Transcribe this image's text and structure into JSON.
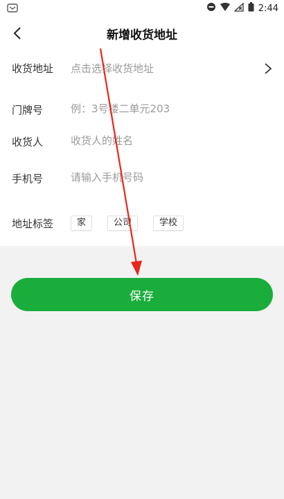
{
  "status_bar": {
    "time": "2:44",
    "icons": [
      "message-icon",
      "dnd-icon",
      "wifi-icon",
      "no-signal-icon",
      "battery-icon"
    ]
  },
  "header": {
    "title": "新增收货地址",
    "back_icon": "chevron-left-icon"
  },
  "form": {
    "address": {
      "label": "收货地址",
      "placeholder": "点击选择收货地址"
    },
    "door_number": {
      "label": "门牌号",
      "placeholder": "例：3号楼二单元203"
    },
    "receiver": {
      "label": "收货人",
      "placeholder": "收货人的姓名"
    },
    "phone": {
      "label": "手机号",
      "placeholder": "请输入手机号码"
    },
    "tags": {
      "label": "地址标签",
      "options": [
        "家",
        "公司",
        "学校"
      ]
    }
  },
  "save_label": "保存",
  "colors": {
    "accent": "#1aad3c",
    "annotation": "#e8261c"
  }
}
